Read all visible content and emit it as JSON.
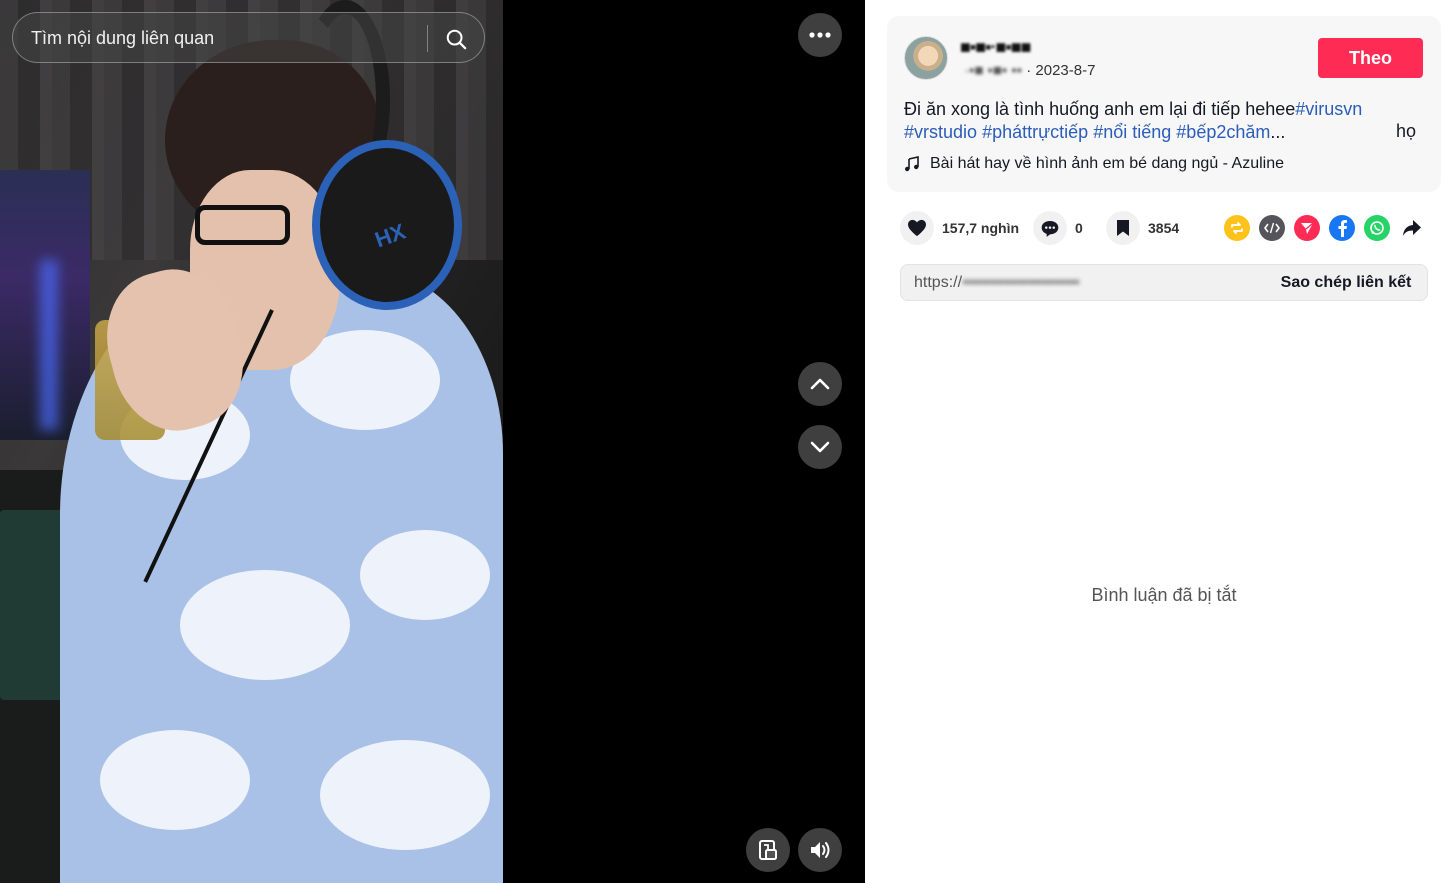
{
  "search": {
    "placeholder": "Tìm nội dung liên quan"
  },
  "icons": {
    "search": "search-icon",
    "more": "more-dots-icon",
    "nav_up": "chevron-up-icon",
    "nav_down": "chevron-down-icon",
    "pip": "mini-player-icon",
    "volume": "volume-icon",
    "music": "music-note-icon",
    "like": "heart-icon",
    "comment": "comment-icon",
    "save": "bookmark-icon",
    "repost": "repost-icon",
    "embed": "embed-icon",
    "send": "send-to-friends-icon",
    "facebook": "facebook-icon",
    "whatsapp": "whatsapp-icon",
    "share_more": "share-arrow-icon"
  },
  "post": {
    "username": "■▪■▪·■▪■■",
    "nickname": "·▪■ ▪■▪ ▪▪",
    "separator": "·",
    "date": "2023-8-7",
    "follow_label": "Theo",
    "caption_text": "Đi ăn xong là tình huống anh em lại đi tiếp hehee",
    "hashtags": [
      "#virusvn",
      "#vrstudio",
      "#pháttrựctiếp",
      "#nổi tiếng",
      "#bếp2chăm"
    ],
    "ellipsis": "...",
    "more_label": "họ",
    "music": "Bài hát hay về hình ảnh em bé dang ngủ - Azuline"
  },
  "stats": {
    "likes": "157,7 nghìn",
    "comments": "0",
    "saves": "3854"
  },
  "link": {
    "prefix": "https://",
    "blurred": "▪▪▪▪▪▪▪▪▪▪▪▪▪▪▪▪▪▪▪▪▪▪▪▪▪",
    "copy_label": "Sao chép liên kết"
  },
  "comments_disabled": "Bình luận đã bị tắt",
  "colors": {
    "follow": "#fe2c55",
    "hashtag": "#2b5db9",
    "repost": "#ffc21a",
    "embed": "#54545a",
    "send": "#fe2c55",
    "facebook": "#1877f2",
    "whatsapp": "#25d366"
  }
}
